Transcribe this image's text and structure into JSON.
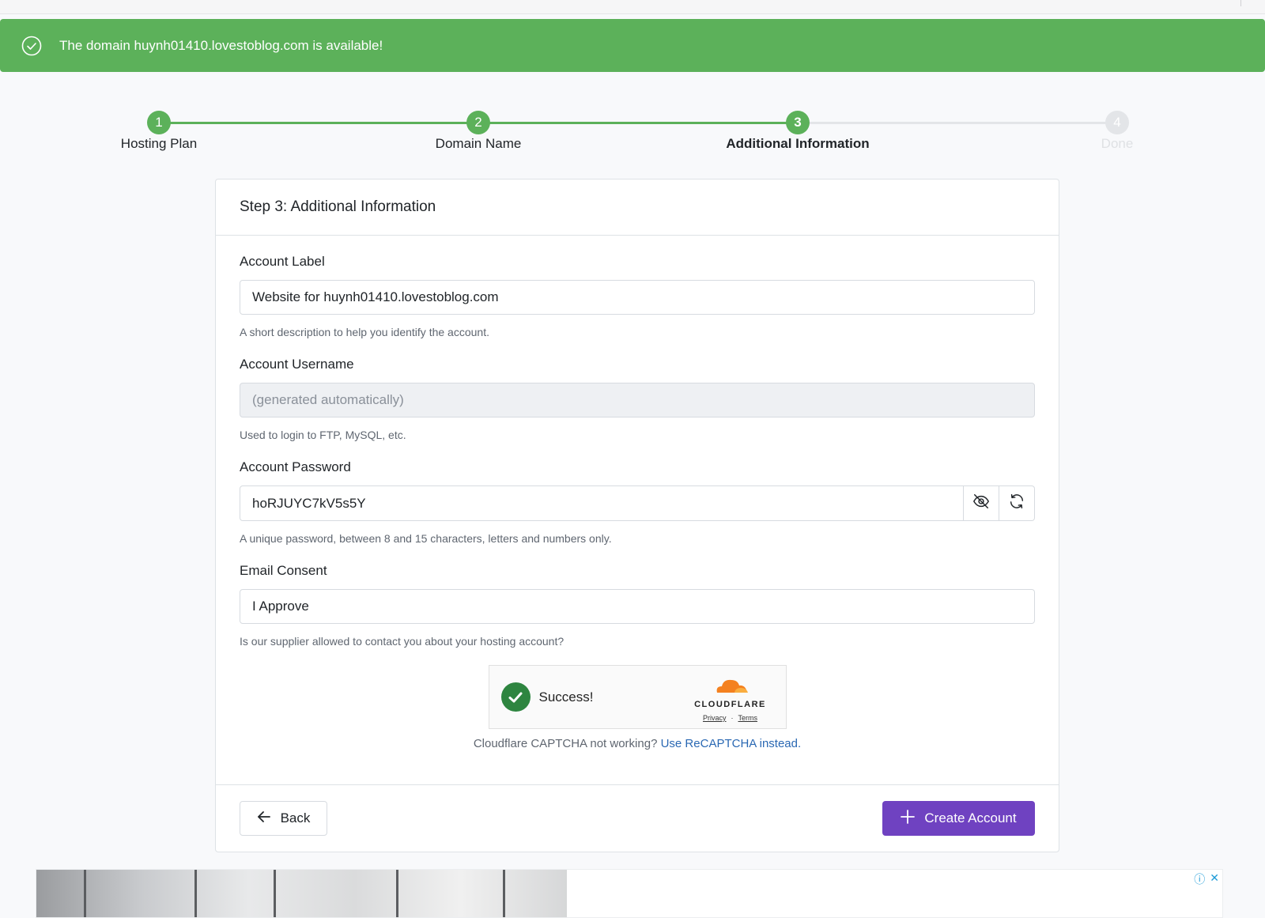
{
  "alert": {
    "message": "The domain huynh01410.lovestoblog.com is available!",
    "icon": "check-circle-icon",
    "color": "#5cb15a"
  },
  "stepper": {
    "steps": [
      {
        "number": "1",
        "label": "Hosting Plan",
        "state": "done"
      },
      {
        "number": "2",
        "label": "Domain Name",
        "state": "done"
      },
      {
        "number": "3",
        "label": "Additional Information",
        "state": "active"
      },
      {
        "number": "4",
        "label": "Done",
        "state": "todo"
      }
    ]
  },
  "card": {
    "title": "Step 3: Additional Information",
    "account_label": {
      "label": "Account Label",
      "value": "Website for huynh01410.lovestoblog.com",
      "help": "A short description to help you identify the account."
    },
    "account_username": {
      "label": "Account Username",
      "placeholder": "(generated automatically)",
      "help": "Used to login to FTP, MySQL, etc."
    },
    "account_password": {
      "label": "Account Password",
      "value": "hoRJUYC7kV5s5Y",
      "help": "A unique password, between 8 and 15 characters, letters and numbers only.",
      "toggle_icon": "eye-slash-icon",
      "refresh_icon": "refresh-icon"
    },
    "email_consent": {
      "label": "Email Consent",
      "value": "I Approve",
      "help": "Is our supplier allowed to contact you about your hosting account?"
    },
    "captcha": {
      "status": "Success!",
      "brand": "CLOUDFLARE",
      "privacy": "Privacy",
      "separator": "·",
      "terms": "Terms",
      "note": "Cloudflare CAPTCHA not working?",
      "note_link": "Use ReCAPTCHA instead",
      "note_end": "."
    },
    "footer": {
      "back_label": "Back",
      "create_label": "Create Account",
      "create_color": "#6f42c1"
    }
  },
  "ad": {
    "info_icon": "ⓘ",
    "close_icon": "✕"
  }
}
